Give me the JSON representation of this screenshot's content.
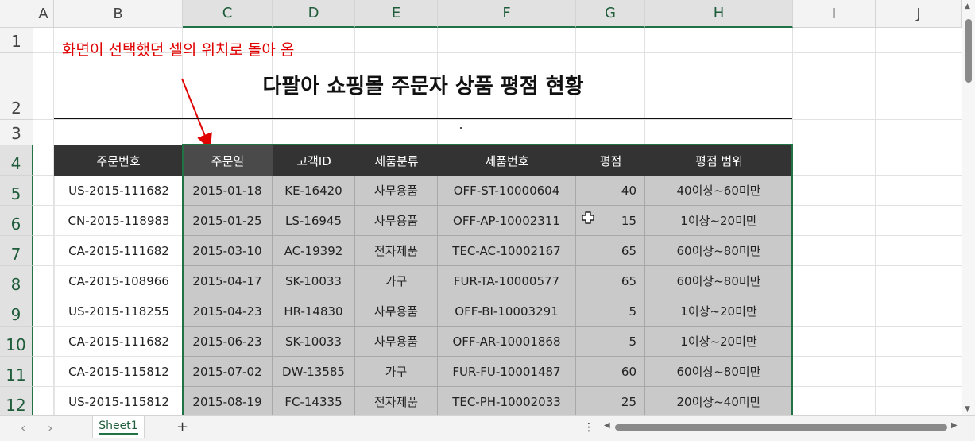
{
  "columns": [
    "A",
    "B",
    "C",
    "D",
    "E",
    "F",
    "G",
    "H",
    "I",
    "J"
  ],
  "rows": [
    "1",
    "2",
    "3",
    "4",
    "5",
    "6",
    "7",
    "8",
    "9",
    "10",
    "11",
    "12"
  ],
  "note": "화면이 선택했던 셀의 위치로 돌아 옴",
  "title": "다팔아 쇼핑몰 주문자 상품 평점 현황",
  "table": {
    "headers": [
      "주문번호",
      "주문일",
      "고객ID",
      "제품분류",
      "제품번호",
      "평점",
      "평점 범위"
    ],
    "rows": [
      [
        "US-2015-111682",
        "2015-01-18",
        "KE-16420",
        "사무용품",
        "OFF-ST-10000604",
        "40",
        "40이상~60미만"
      ],
      [
        "CN-2015-118983",
        "2015-01-25",
        "LS-16945",
        "사무용품",
        "OFF-AP-10002311",
        "15",
        "1이상~20미만"
      ],
      [
        "CA-2015-111682",
        "2015-03-10",
        "AC-19392",
        "전자제품",
        "TEC-AC-10002167",
        "65",
        "60이상~80미만"
      ],
      [
        "CA-2015-108966",
        "2015-04-17",
        "SK-10033",
        "가구",
        "FUR-TA-10000577",
        "65",
        "60이상~80미만"
      ],
      [
        "US-2015-118255",
        "2015-04-23",
        "HR-14830",
        "사무용품",
        "OFF-BI-10003291",
        "5",
        "1이상~20미만"
      ],
      [
        "CA-2015-111682",
        "2015-06-23",
        "SK-10033",
        "사무용품",
        "OFF-AR-10001868",
        "5",
        "1이상~20미만"
      ],
      [
        "CA-2015-115812",
        "2015-07-02",
        "DW-13585",
        "가구",
        "FUR-FU-10001487",
        "60",
        "60이상~80미만"
      ],
      [
        "US-2015-115812",
        "2015-08-19",
        "FC-14335",
        "전자제품",
        "TEC-PH-10002033",
        "25",
        "20이상~40미만"
      ]
    ]
  },
  "sheet_tab": "Sheet1",
  "add_sheet": "+",
  "colors": {
    "accent": "#217346",
    "header_bg": "#333333",
    "selection_fill": "#c9c9c9",
    "note": "#e00000"
  }
}
